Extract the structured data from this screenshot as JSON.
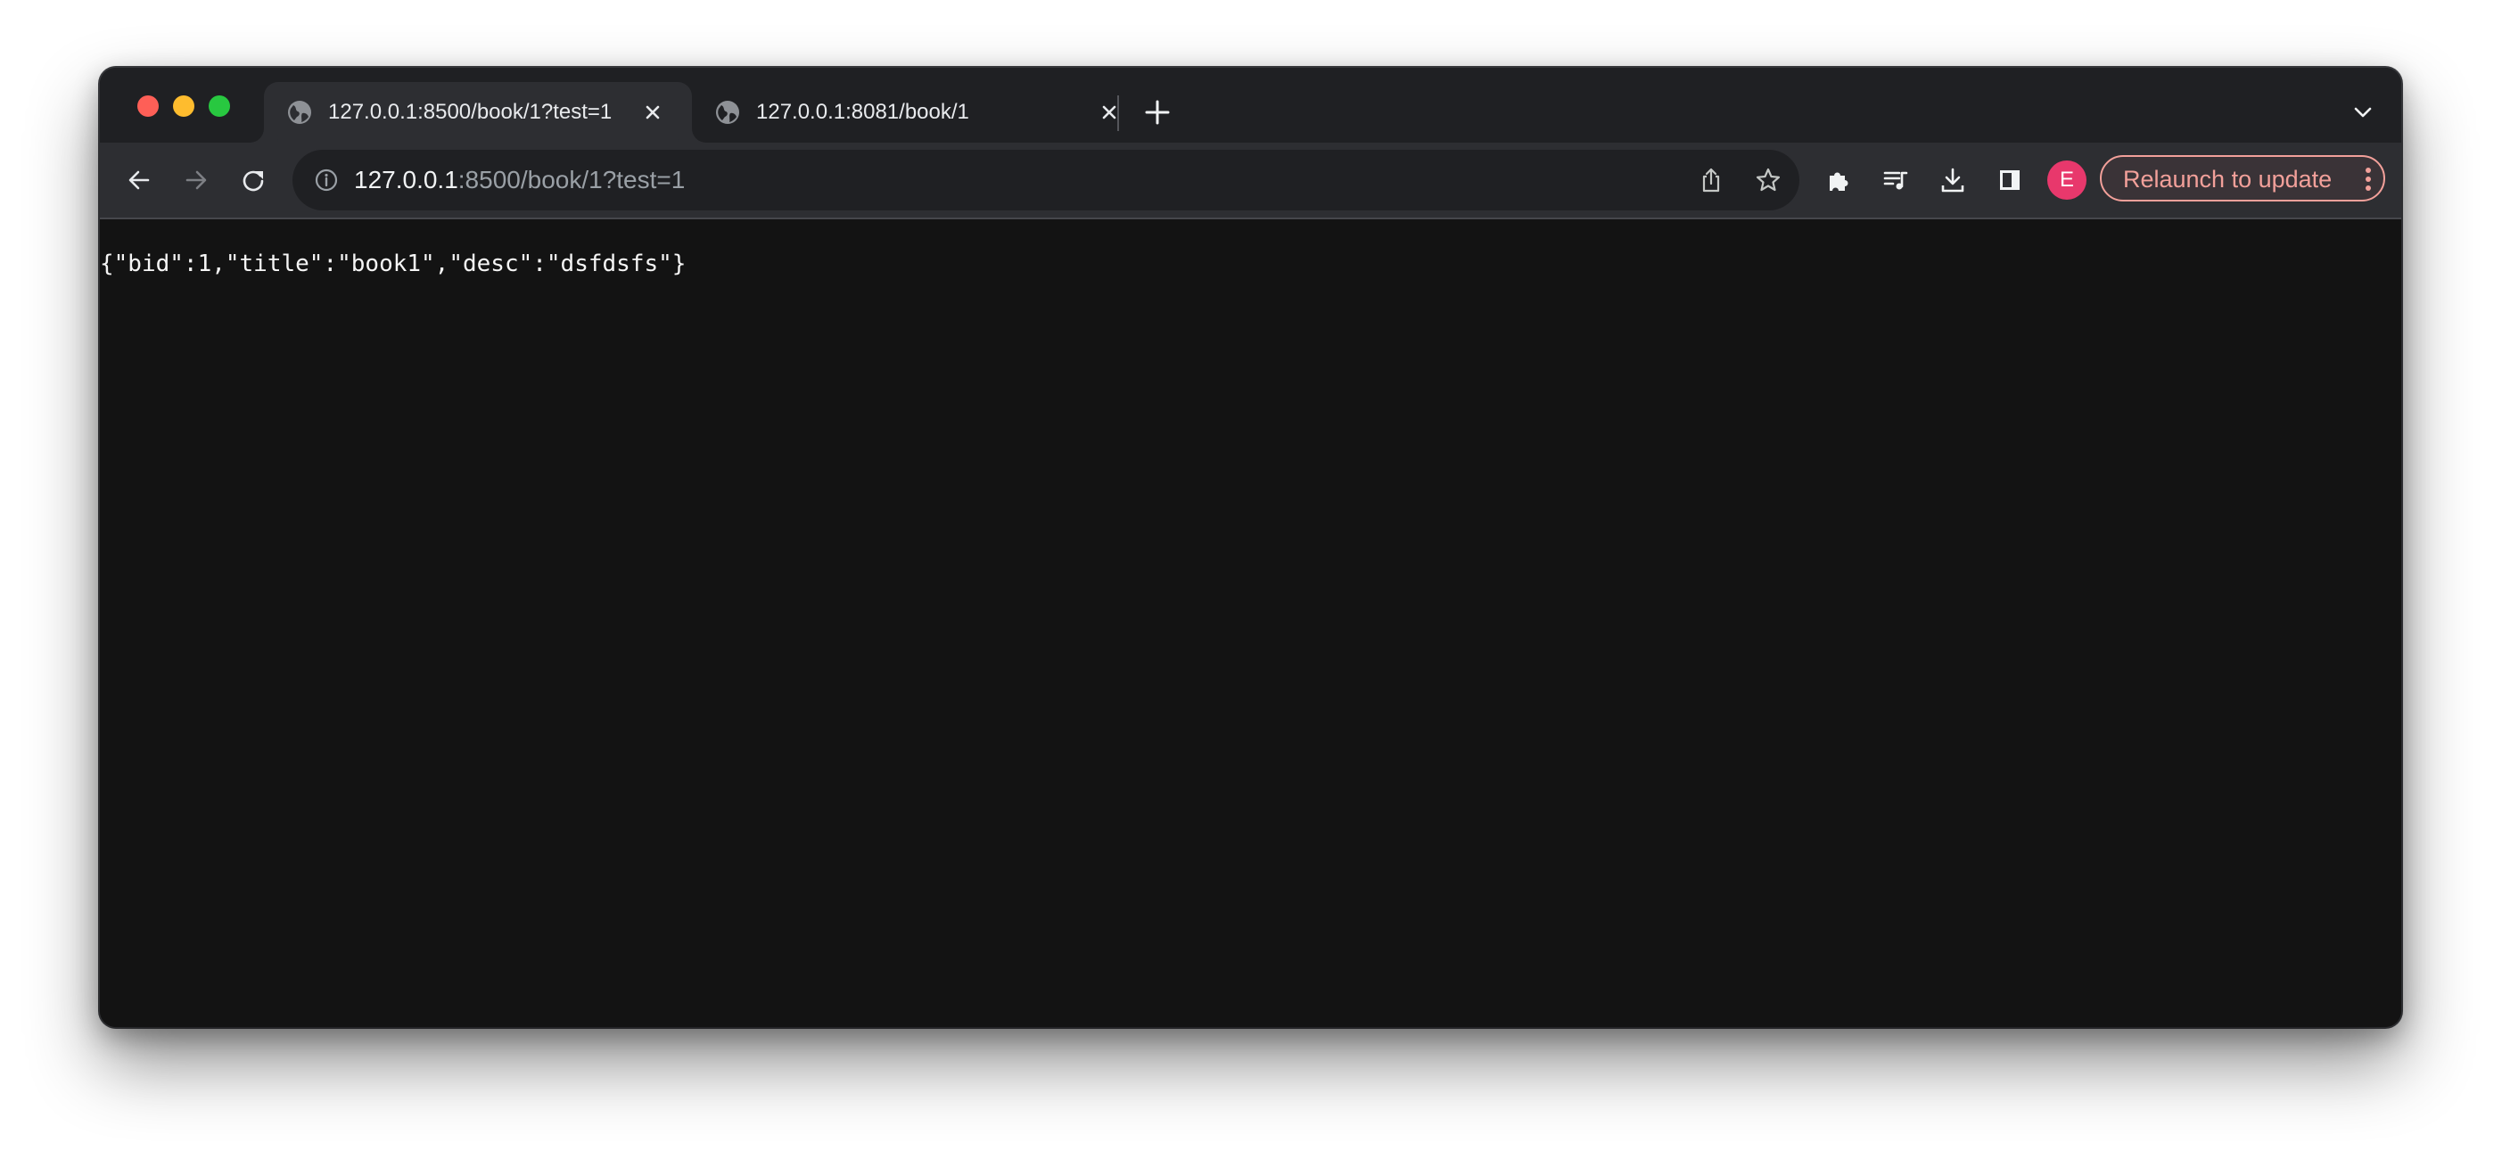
{
  "window": {
    "traffic_lights": [
      "close",
      "minimize",
      "zoom"
    ]
  },
  "tabs": [
    {
      "title": "127.0.0.1:8500/book/1?test=1",
      "icon": "globe-icon",
      "active": true
    },
    {
      "title": "127.0.0.1:8081/book/1",
      "icon": "globe-icon",
      "active": false
    }
  ],
  "toolbar": {
    "url_host": "127.0.0.1",
    "url_rest": ":8500/book/1?test=1",
    "avatar_letter": "E",
    "relaunch_label": "Relaunch to update"
  },
  "colors": {
    "avatar": "#e8386c",
    "relaunch_accent": "#f2a09a"
  },
  "page": {
    "body_text": "{\"bid\":1,\"title\":\"book1\",\"desc\":\"dsfdsfs\"}"
  }
}
